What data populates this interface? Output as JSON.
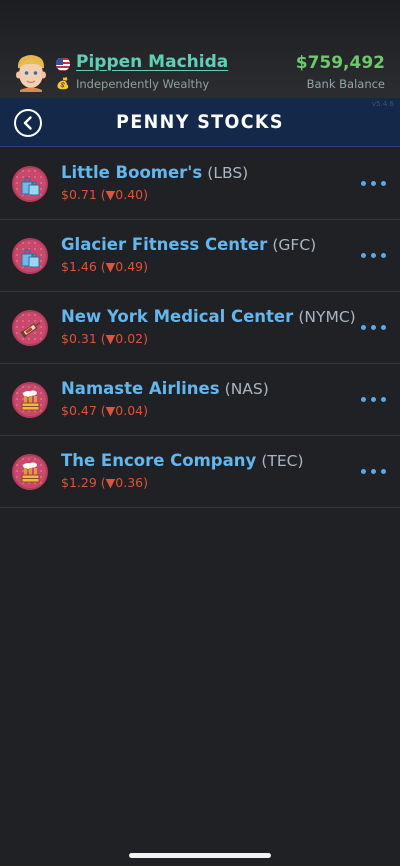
{
  "profile": {
    "name": "Pippen Machida",
    "status": "Independently Wealthy",
    "balance": "$759,492",
    "balance_label": "Bank Balance",
    "avatar_icon": "avatar-face-icon",
    "flag_icon": "us-flag-icon",
    "status_icon": "money-bag-icon"
  },
  "navbar": {
    "title": "PENNY STOCKS",
    "back_icon": "back-chevron-icon",
    "version": "v5.4.6"
  },
  "stocks": [
    {
      "name": "Little Boomer's",
      "ticker": "(LBS)",
      "price": "$0.71",
      "change": "(▼0.40)",
      "icon": "shopping-bags-icon"
    },
    {
      "name": "Glacier Fitness Center",
      "ticker": "(GFC)",
      "price": "$1.46",
      "change": "(▼0.49)",
      "icon": "shopping-bags-icon"
    },
    {
      "name": "New York Medical Center",
      "ticker": "(NYMC)",
      "price": "$0.31",
      "change": "(▼0.02)",
      "icon": "syringe-icon"
    },
    {
      "name": "Namaste Airlines",
      "ticker": "(NAS)",
      "price": "$0.47",
      "change": "(▼0.04)",
      "icon": "factory-icon"
    },
    {
      "name": "The Encore Company",
      "ticker": "(TEC)",
      "price": "$1.29",
      "change": "(▼0.36)",
      "icon": "factory-icon"
    }
  ],
  "colors": {
    "background": "#202124",
    "navbar": "#14294a",
    "company_name": "#62b7ee",
    "price_down": "#e0523a",
    "balance": "#6dc96b",
    "player_name": "#5fd0b6"
  }
}
